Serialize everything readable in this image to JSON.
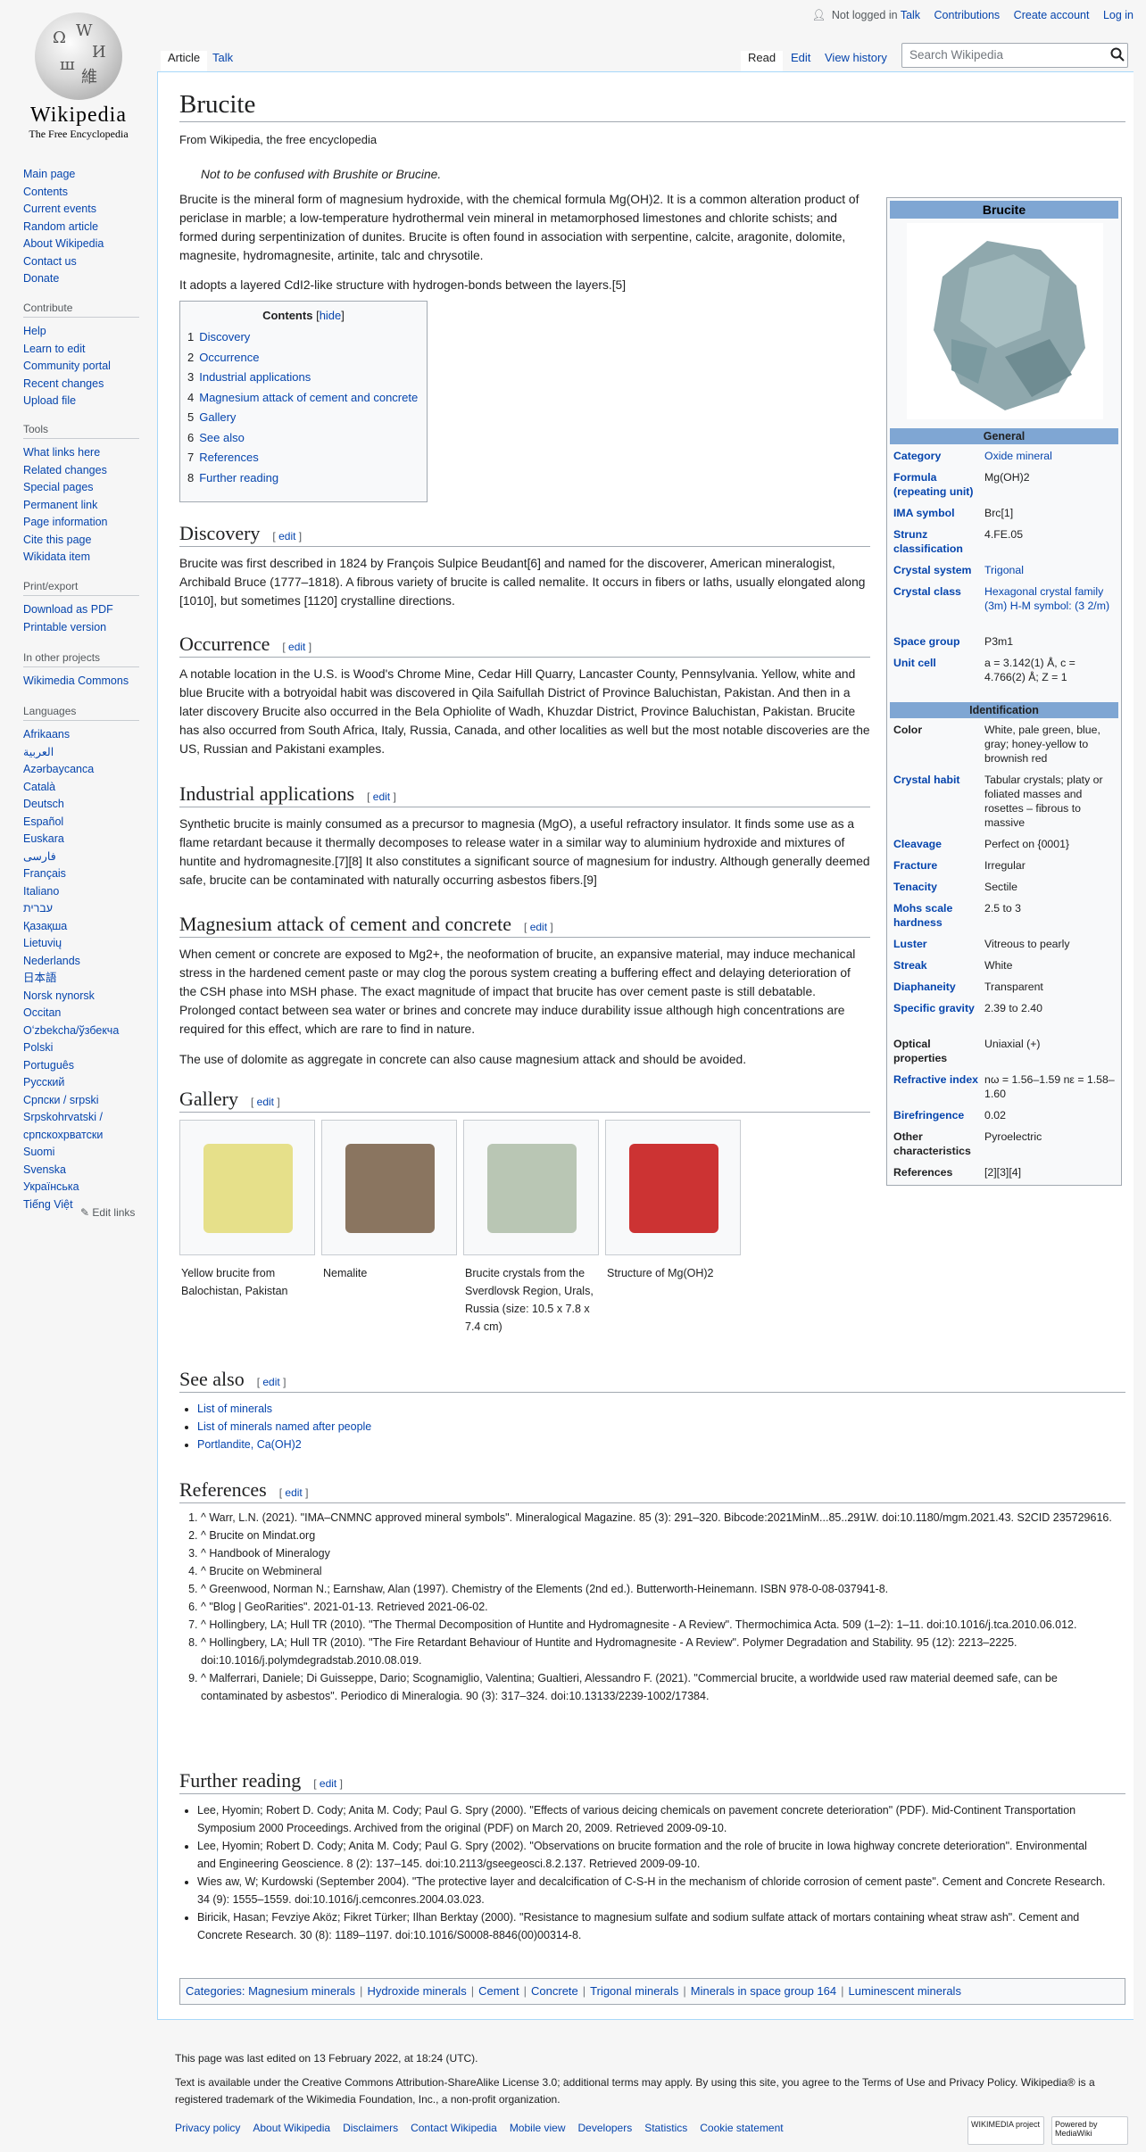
{
  "sidebar": {
    "wordmark": "Wikipedia",
    "tagline": "The Free Encyclopedia",
    "nav": [
      "Main page",
      "Contents",
      "Current events",
      "Random article",
      "About Wikipedia",
      "Contact us",
      "Donate"
    ],
    "contribute_title": "Contribute",
    "contribute": [
      "Help",
      "Learn to edit",
      "Community portal",
      "Recent changes",
      "Upload file"
    ],
    "tools_title": "Tools",
    "tools": [
      "What links here",
      "Related changes",
      "Special pages",
      "Permanent link",
      "Page information",
      "Cite this page",
      "Wikidata item"
    ],
    "print_title": "Print/export",
    "print": [
      "Download as PDF",
      "Printable version"
    ],
    "other_title": "In other projects",
    "other": [
      "Wikimedia Commons"
    ],
    "lang_title": "Languages",
    "languages": [
      "Afrikaans",
      "العربية",
      "Azərbaycanca",
      "Català",
      "Deutsch",
      "Español",
      "Euskara",
      "فارسی",
      "Français",
      "Italiano",
      "עברית",
      "Қазақша",
      "Lietuvių",
      "Nederlands",
      "日本語",
      "Norsk nynorsk",
      "Occitan",
      "Oʻzbekcha/ўзбекча",
      "Polski",
      "Português",
      "Русский",
      "Српски / srpski",
      "Srpskohrvatski / српскохрватски",
      "Suomi",
      "Svenska",
      "Українська",
      "Tiếng Việt"
    ],
    "edit_links": "Edit links"
  },
  "personal": {
    "not_logged": "Not logged in",
    "talk": "Talk",
    "contributions": "Contributions",
    "create": "Create account",
    "login": "Log in"
  },
  "tabs": {
    "article": "Article",
    "talk": "Talk",
    "read": "Read",
    "edit": "Edit",
    "history": "View history"
  },
  "search": {
    "placeholder": "Search Wikipedia"
  },
  "article": {
    "title": "Brucite",
    "from": "From Wikipedia, the free encyclopedia",
    "hatnote": "Not to be confused with Brushite or Brucine.",
    "intro1": "Brucite is the mineral form of magnesium hydroxide, with the chemical formula Mg(OH)2. It is a common alteration product of periclase in marble; a low-temperature hydrothermal vein mineral in metamorphosed limestones and chlorite schists; and formed during serpentinization of dunites. Brucite is often found in association with serpentine, calcite, aragonite, dolomite, magnesite, hydromagnesite, artinite, talc and chrysotile.",
    "intro2": "It adopts a layered CdI2-like structure with hydrogen-bonds between the layers.[5]",
    "edit": "edit",
    "toc_title": "Contents",
    "toc_hide": "hide",
    "toc": [
      {
        "n": "1",
        "t": "Discovery"
      },
      {
        "n": "2",
        "t": "Occurrence"
      },
      {
        "n": "3",
        "t": "Industrial applications"
      },
      {
        "n": "4",
        "t": "Magnesium attack of cement and concrete"
      },
      {
        "n": "5",
        "t": "Gallery"
      },
      {
        "n": "6",
        "t": "See also"
      },
      {
        "n": "7",
        "t": "References"
      },
      {
        "n": "8",
        "t": "Further reading"
      }
    ],
    "h_discovery": "Discovery",
    "discovery": "Brucite was first described in 1824 by François Sulpice Beudant[6] and named for the discoverer, American mineralogist, Archibald Bruce (1777–1818). A fibrous variety of brucite is called nemalite. It occurs in fibers or laths, usually elongated along [1010], but sometimes [1120] crystalline directions.",
    "h_occurrence": "Occurrence",
    "occurrence": "A notable location in the U.S. is Wood's Chrome Mine, Cedar Hill Quarry, Lancaster County, Pennsylvania. Yellow, white and blue Brucite with a botryoidal habit was discovered in Qila Saifullah District of Province Baluchistan, Pakistan. And then in a later discovery Brucite also occurred in the Bela Ophiolite of Wadh, Khuzdar District, Province Baluchistan, Pakistan. Brucite has also occurred from South Africa, Italy, Russia, Canada, and other localities as well but the most notable discoveries are the US, Russian and Pakistani examples.",
    "h_industrial": "Industrial applications",
    "industrial": "Synthetic brucite is mainly consumed as a precursor to magnesia (MgO), a useful refractory insulator. It finds some use as a flame retardant because it thermally decomposes to release water in a similar way to aluminium hydroxide and mixtures of huntite and hydromagnesite.[7][8] It also constitutes a significant source of magnesium for industry. Although generally deemed safe, brucite can be contaminated with naturally occurring asbestos fibers.[9]",
    "h_magnesium": "Magnesium attack of cement and concrete",
    "magnesium1": "When cement or concrete are exposed to Mg2+, the neoformation of brucite, an expansive material, may induce mechanical stress in the hardened cement paste or may clog the porous system creating a buffering effect and delaying deterioration of the CSH phase into MSH phase. The exact magnitude of impact that brucite has over cement paste is still debatable. Prolonged contact between sea water or brines and concrete may induce durability issue although high concentrations are required for this effect, which are rare to find in nature.",
    "magnesium2": "The use of dolomite as aggregate in concrete can also cause magnesium attack and should be avoided.",
    "h_gallery": "Gallery",
    "gallery": [
      {
        "caption": "Yellow brucite from Balochistan, Pakistan",
        "color": "#e6e08a"
      },
      {
        "caption": "Nemalite",
        "color": "#8a7560"
      },
      {
        "caption": "Brucite crystals from the Sverdlovsk Region, Urals, Russia (size: 10.5 x 7.8 x 7.4 cm)",
        "color": "#b9c6b4"
      },
      {
        "caption": "Structure of Mg(OH)2",
        "color": "#c33"
      }
    ],
    "h_seealso": "See also",
    "seealso": [
      "List of minerals",
      "List of minerals named after people",
      "Portlandite, Ca(OH)2"
    ],
    "h_refs": "References",
    "refs": [
      "^ Warr, L.N. (2021). \"IMA–CNMNC approved mineral symbols\". Mineralogical Magazine. 85 (3): 291–320. Bibcode:2021MinM...85..291W. doi:10.1180/mgm.2021.43. S2CID 235729616.",
      "^ Brucite on Mindat.org",
      "^ Handbook of Mineralogy",
      "^ Brucite on Webmineral",
      "^ Greenwood, Norman N.; Earnshaw, Alan (1997). Chemistry of the Elements (2nd ed.). Butterworth-Heinemann. ISBN 978-0-08-037941-8.",
      "^ \"Blog | GeoRarities\". 2021-01-13. Retrieved 2021-06-02.",
      "^ Hollingbery, LA; Hull TR (2010). \"The Thermal Decomposition of Huntite and Hydromagnesite - A Review\". Thermochimica Acta. 509 (1–2): 1–11. doi:10.1016/j.tca.2010.06.012.",
      "^ Hollingbery, LA; Hull TR (2010). \"The Fire Retardant Behaviour of Huntite and Hydromagnesite - A Review\". Polymer Degradation and Stability. 95 (12): 2213–2225. doi:10.1016/j.polymdegradstab.2010.08.019.",
      "^ Malferrari, Daniele; Di Guisseppe, Dario; Scognamiglio, Valentina; Gualtieri, Alessandro F. (2021). \"Commercial brucite, a worldwide used raw material deemed safe, can be contaminated by asbestos\". Periodico di Mineralogia. 90 (3): 317–324. doi:10.13133/2239-1002/17384."
    ],
    "h_further": "Further reading",
    "further": [
      "Lee, Hyomin; Robert D. Cody; Anita M. Cody; Paul G. Spry (2000). \"Effects of various deicing chemicals on pavement concrete deterioration\" (PDF). Mid-Continent Transportation Symposium 2000 Proceedings. Archived from the original (PDF) on March 20, 2009. Retrieved 2009-09-10.",
      "Lee, Hyomin; Robert D. Cody; Anita M. Cody; Paul G. Spry (2002). \"Observations on brucite formation and the role of brucite in Iowa highway concrete deterioration\". Environmental and Engineering Geoscience. 8 (2): 137–145. doi:10.2113/gseegeosci.8.2.137. Retrieved 2009-09-10.",
      "Wies aw, W; Kurdowski (September 2004). \"The protective layer and decalcification of C-S-H in the mechanism of chloride corrosion of cement paste\". Cement and Concrete Research. 34 (9): 1555–1559. doi:10.1016/j.cemconres.2004.03.023.",
      "Biricik, Hasan; Fevziye Aköz; Fikret Türker; Ilhan Berktay (2000). \"Resistance to magnesium sulfate and sodium sulfate attack of mortars containing wheat straw ash\". Cement and Concrete Research. 30 (8): 1189–1197. doi:10.1016/S0008-8846(00)00314-8."
    ],
    "categories_label": "Categories:",
    "categories": [
      "Magnesium minerals",
      "Hydroxide minerals",
      "Cement",
      "Concrete",
      "Trigonal minerals",
      "Minerals in space group 164",
      "Luminescent minerals"
    ]
  },
  "infobox": {
    "title": "Brucite",
    "general": "General",
    "identification": "Identification",
    "rows_general": [
      {
        "k": "Category",
        "v": "Oxide mineral",
        "link": true
      },
      {
        "k": "Formula (repeating unit)",
        "v": "Mg(OH)2",
        "link": false
      },
      {
        "k": "IMA symbol",
        "v": "Brc[1]",
        "link": false
      },
      {
        "k": "Strunz classification",
        "v": "4.FE.05",
        "link": false
      },
      {
        "k": "Crystal system",
        "v": "Trigonal",
        "link": true
      },
      {
        "k": "Crystal class",
        "v": "Hexagonal crystal family (3m) H-M symbol: (3 2/m)",
        "link": true
      },
      {
        "k": "Space group",
        "v": "P3m1",
        "link": false
      },
      {
        "k": "Unit cell",
        "v": "a = 3.142(1) Å, c = 4.766(2) Å; Z = 1",
        "link": false
      }
    ],
    "rows_ident": [
      {
        "k": "Color",
        "v": "White, pale green, blue, gray; honey-yellow to brownish red",
        "plain": true
      },
      {
        "k": "Crystal habit",
        "v": "Tabular crystals; platy or foliated masses and rosettes – fibrous to massive",
        "plain": false
      },
      {
        "k": "Cleavage",
        "v": "Perfect on {0001}",
        "plain": false
      },
      {
        "k": "Fracture",
        "v": "Irregular",
        "plain": false
      },
      {
        "k": "Tenacity",
        "v": "Sectile",
        "plain": false
      },
      {
        "k": "Mohs scale hardness",
        "v": "2.5 to 3",
        "plain": false
      },
      {
        "k": "Luster",
        "v": "Vitreous to pearly",
        "plain": false
      },
      {
        "k": "Streak",
        "v": "White",
        "plain": false
      },
      {
        "k": "Diaphaneity",
        "v": "Transparent",
        "plain": false
      },
      {
        "k": "Specific gravity",
        "v": "2.39 to 2.40",
        "plain": false
      },
      {
        "k": "Optical properties",
        "v": "Uniaxial (+)",
        "plain": true
      },
      {
        "k": "Refractive index",
        "v": "nω = 1.56–1.59 nε = 1.58–1.60",
        "plain": false
      },
      {
        "k": "Birefringence",
        "v": "0.02",
        "plain": false
      },
      {
        "k": "Other characteristics",
        "v": "Pyroelectric",
        "plain": true
      },
      {
        "k": "References",
        "v": "[2][3][4]",
        "plain": true
      }
    ]
  },
  "footer": {
    "edited": "This page was last edited on 13 February 2022, at 18:24 (UTC).",
    "license": "Text is available under the Creative Commons Attribution-ShareAlike License 3.0; additional terms may apply. By using this site, you agree to the Terms of Use and Privacy Policy. Wikipedia® is a registered trademark of the Wikimedia Foundation, Inc., a non-profit organization.",
    "links": [
      "Privacy policy",
      "About Wikipedia",
      "Disclaimers",
      "Contact Wikipedia",
      "Mobile view",
      "Developers",
      "Statistics",
      "Cookie statement"
    ],
    "badge1": "WIKIMEDIA project",
    "badge2": "Powered by MediaWiki"
  }
}
